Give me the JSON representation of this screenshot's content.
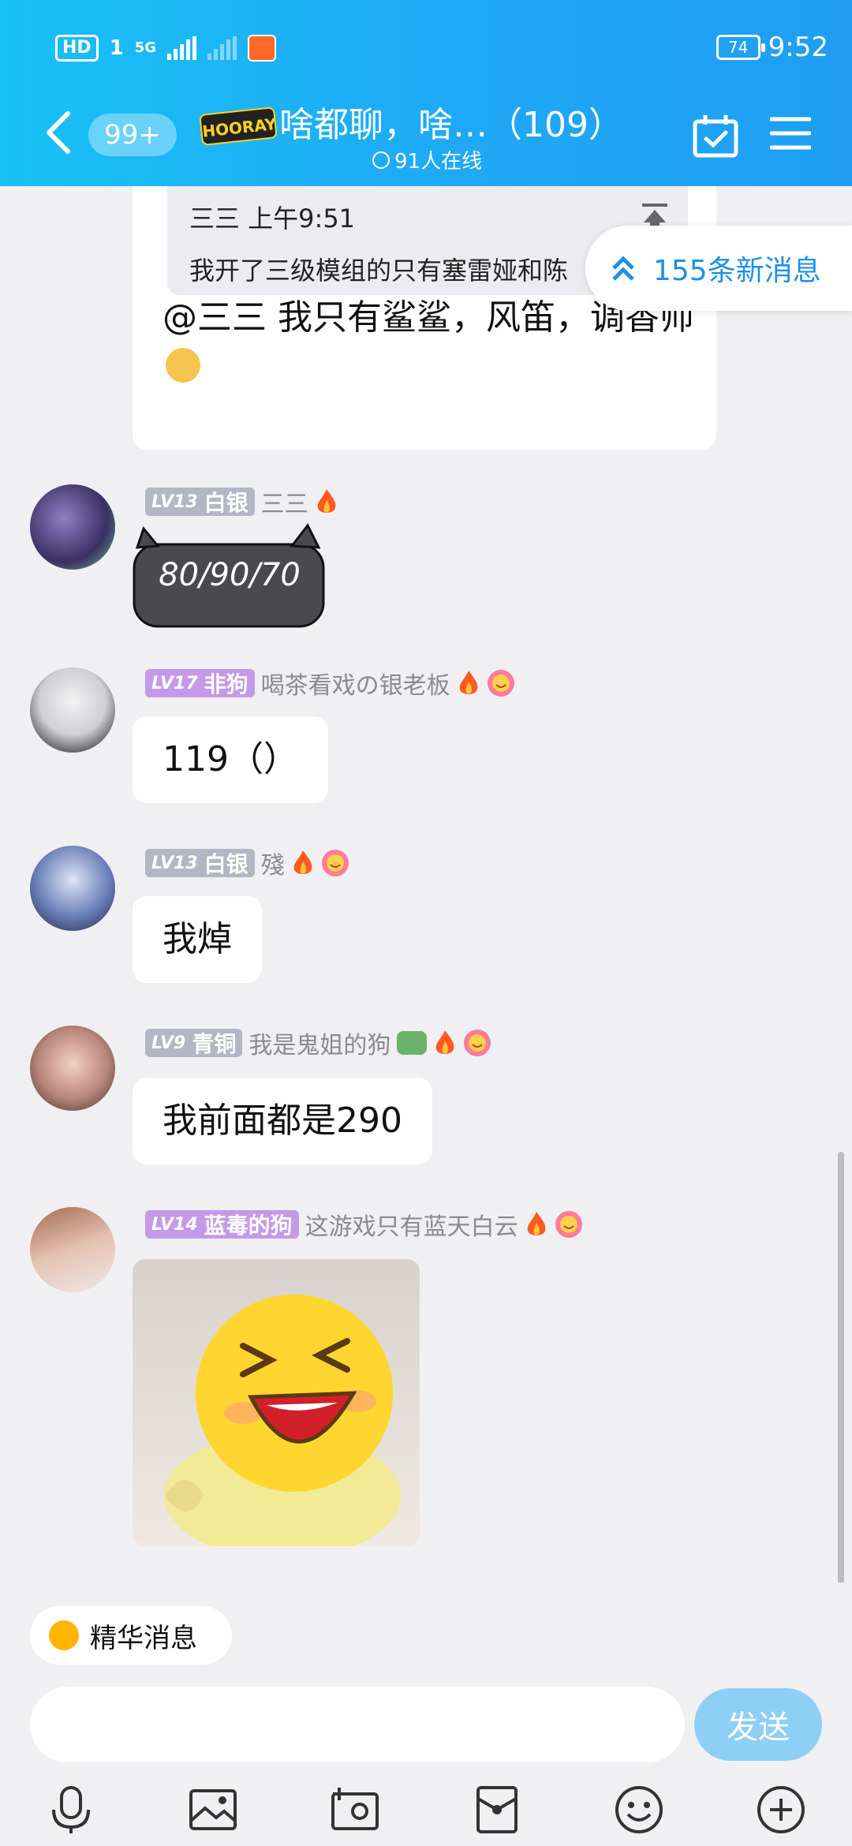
{
  "status": {
    "network": "5G",
    "hd": "HD",
    "sim": "1",
    "battery": "74",
    "time": "9:52"
  },
  "header": {
    "unread_badge": "99+",
    "group_logo_text": "HOORAY",
    "title": "啥都聊，啥…（109）",
    "online_count": "91人在线"
  },
  "new_messages": {
    "label": "155条新消息"
  },
  "quote": {
    "sender_time": "三三  上午9:51",
    "text": "我开了三级模组的只有塞雷娅和陈",
    "reply": "@三三 我只有鲨鲨，风笛，调香师"
  },
  "messages": [
    {
      "level": "LV13",
      "title": "白银",
      "name": "三三",
      "content": "80/90/70",
      "type": "sticker"
    },
    {
      "level": "LV17",
      "title": "非狗",
      "name": "喝茶看戏の银老板",
      "content": "119（）",
      "type": "text"
    },
    {
      "level": "LV13",
      "title": "白银",
      "name": "殘",
      "content": "我焯",
      "type": "text"
    },
    {
      "level": "LV9",
      "title": "青铜",
      "name": "我是鬼姐的狗",
      "content": "我前面都是290",
      "type": "text"
    },
    {
      "level": "LV14",
      "title": "蓝毒的狗",
      "name": "这游戏只有蓝天白云",
      "content": "",
      "type": "image"
    }
  ],
  "bottom": {
    "essence_label": "精华消息",
    "input_value": "",
    "send_label": "发送"
  },
  "colors": {
    "header_start": "#19c1f6",
    "header_end": "#1f9ef3",
    "accent": "#1e8fe8",
    "send_button": "#8ecff5"
  }
}
